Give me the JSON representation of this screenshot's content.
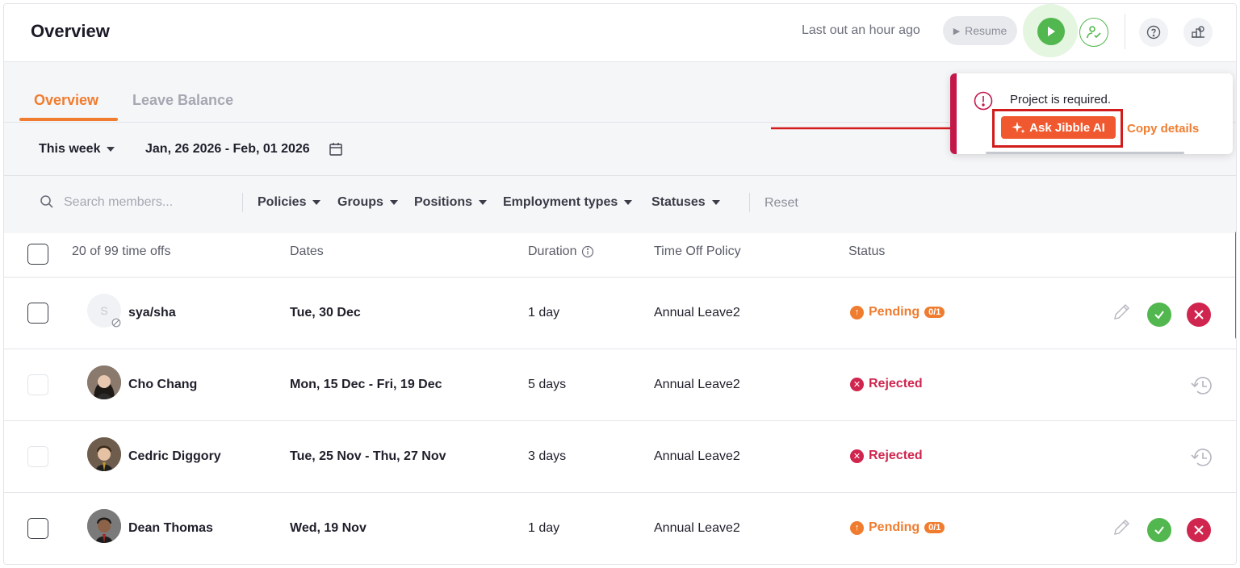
{
  "header": {
    "title": "Overview",
    "last_out": "Last out an hour ago",
    "resume_label": "Resume"
  },
  "tabs": [
    {
      "label": "Overview",
      "active": true
    },
    {
      "label": "Leave Balance",
      "active": false
    }
  ],
  "range": {
    "period": "This week",
    "dates": "Jan, 26 2026 - Feb, 01 2026"
  },
  "filters": {
    "search_placeholder": "Search members...",
    "items": [
      "Policies",
      "Groups",
      "Positions",
      "Employment types",
      "Statuses"
    ],
    "reset_label": "Reset"
  },
  "table": {
    "count_label": "20 of 99 time offs",
    "columns": [
      "Dates",
      "Duration",
      "Time Off Policy",
      "Status"
    ],
    "rows": [
      {
        "name": "sya/sha",
        "initial": "S",
        "dates": "Tue, 30 Dec",
        "duration": "1 day",
        "policy": "Annual Leave2",
        "status": "Pending",
        "badge": "0/1"
      },
      {
        "name": "Cho Chang",
        "dates": "Mon, 15 Dec - Fri, 19 Dec",
        "duration": "5 days",
        "policy": "Annual Leave2",
        "status": "Rejected"
      },
      {
        "name": "Cedric Diggory",
        "dates": "Tue, 25 Nov - Thu, 27 Nov",
        "duration": "3 days",
        "policy": "Annual Leave2",
        "status": "Rejected"
      },
      {
        "name": "Dean Thomas",
        "dates": "Wed, 19 Nov",
        "duration": "1 day",
        "policy": "Annual Leave2",
        "status": "Pending",
        "badge": "0/1"
      }
    ]
  },
  "toast": {
    "message": "Project is required.",
    "ask_ai_label": "Ask Jibble AI",
    "copy_label": "Copy details"
  },
  "colors": {
    "accent": "#f07c2f",
    "success": "#52b74e",
    "danger": "#d0254e",
    "annotation": "#d21b1b"
  },
  "icons": [
    "search-icon",
    "calendar-icon",
    "info-icon",
    "pencil-icon",
    "check-icon",
    "close-icon",
    "history-icon",
    "play-icon",
    "person-check-icon",
    "help-icon",
    "org-icon",
    "sparkle-icon",
    "alert-icon"
  ]
}
